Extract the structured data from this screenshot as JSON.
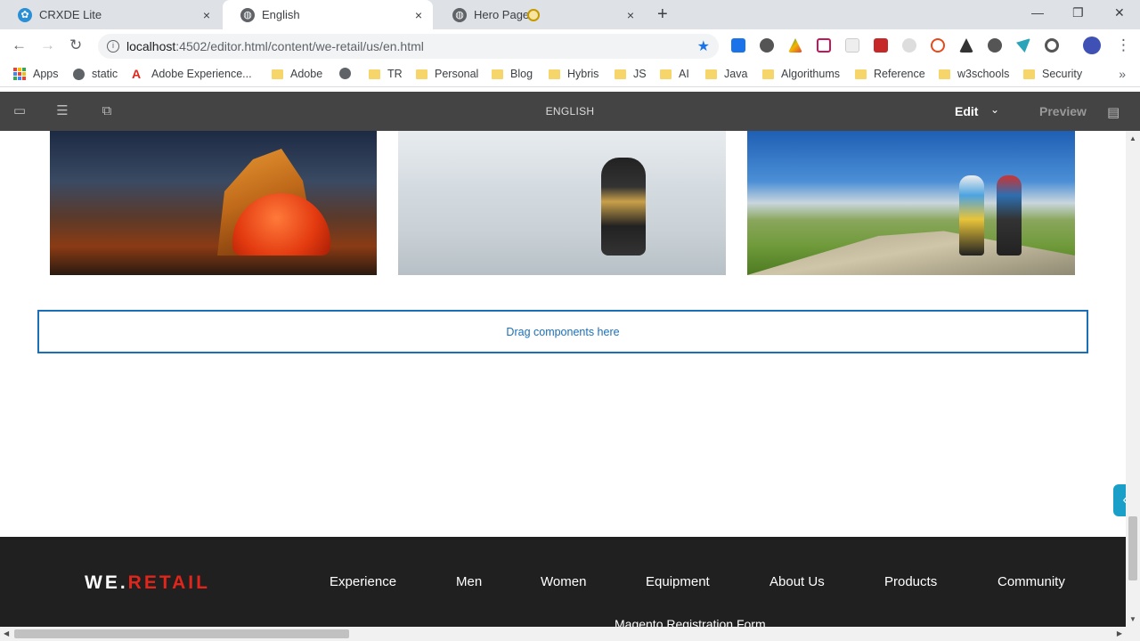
{
  "tabs": [
    {
      "title": "CRXDE Lite",
      "icon": "crxde-icon",
      "active": false
    },
    {
      "title": "English",
      "icon": "globe-icon",
      "active": true
    },
    {
      "title": "Hero Page",
      "icon": "globe-icon",
      "active": false
    }
  ],
  "tab_close": "×",
  "new_tab": "+",
  "window": {
    "minimize": "—",
    "restore": "❐",
    "close": "✕"
  },
  "nav": {
    "back": "←",
    "forward": "→",
    "reload": "↻"
  },
  "address": {
    "host": "localhost",
    "path": ":4502/editor.html/content/we-retail/us/en.html",
    "star": "★"
  },
  "bookmarks": [
    {
      "label": "Apps",
      "type": "apps"
    },
    {
      "label": "static",
      "type": "globe"
    },
    {
      "label": "Adobe Experience...",
      "type": "adobe"
    },
    {
      "label": "Adobe",
      "type": "folder"
    },
    {
      "label": "",
      "type": "globe"
    },
    {
      "label": "TR",
      "type": "folder"
    },
    {
      "label": "Personal",
      "type": "folder"
    },
    {
      "label": "Blog",
      "type": "folder"
    },
    {
      "label": "Hybris",
      "type": "folder"
    },
    {
      "label": "JS",
      "type": "folder"
    },
    {
      "label": "AI",
      "type": "folder"
    },
    {
      "label": "Java",
      "type": "folder"
    },
    {
      "label": "Algorithums",
      "type": "folder"
    },
    {
      "label": "Reference",
      "type": "folder"
    },
    {
      "label": "w3schools",
      "type": "folder"
    },
    {
      "label": "Security",
      "type": "folder"
    }
  ],
  "bookmarks_more": "»",
  "editor": {
    "page_title": "ENGLISH",
    "mode": "Edit",
    "mode_caret": "⌄",
    "preview": "Preview"
  },
  "dropzone": {
    "label": "Drag components here"
  },
  "sidepanel_toggle": "«",
  "footer": {
    "logo_we": "WE.",
    "logo_retail": "RETAIL",
    "nav": [
      "Experience",
      "Men",
      "Women",
      "Equipment",
      "About Us",
      "Products",
      "Community"
    ],
    "sub_item": "Magento Registration Form"
  },
  "colors": {
    "accent": "#1b6fb8",
    "editor_bar": "#444444",
    "footer": "#202020",
    "brand_red": "#e1251b",
    "toggle": "#1a9fc9"
  }
}
